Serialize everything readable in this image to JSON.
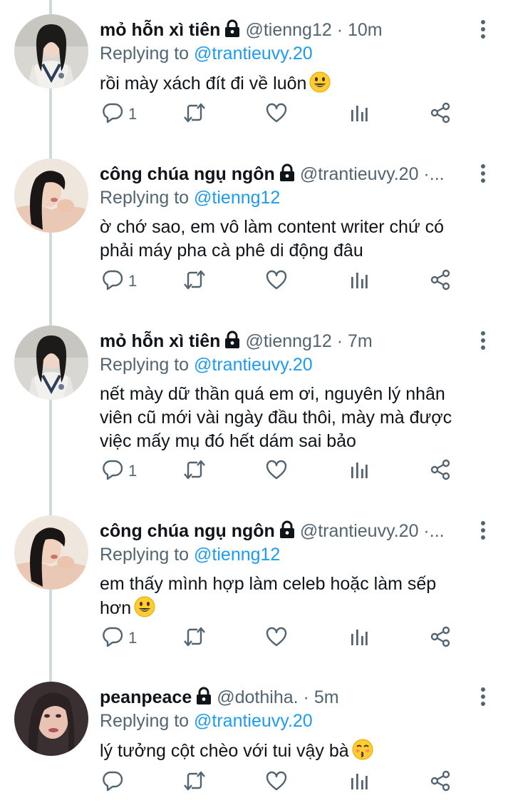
{
  "tweets": [
    {
      "name": "mỏ hỗn xì tiên",
      "handle": "@tienng12",
      "time": "10m",
      "replying_prefix": "Replying to",
      "replying_handle": "@trantieuvy.20",
      "lines": [
        "rồi mày xách đít đi về luôn"
      ],
      "emoji": "grinning-face-emoji",
      "reply_count": "1",
      "avatar": "avatar-girl-school-uniform"
    },
    {
      "name": "công chúa ngụ ngôn",
      "handle": "@trantieuvy.20 ·...",
      "time": "",
      "replying_prefix": "Replying to",
      "replying_handle": "@tienng12",
      "lines": [
        "ờ chớ sao, em vô làm content writer chứ có",
        "phải máy pha cà phê di động đâu"
      ],
      "emoji": "",
      "reply_count": "1",
      "avatar": "avatar-girl-long-hair"
    },
    {
      "name": "mỏ hỗn xì tiên",
      "handle": "@tienng12",
      "time": "7m",
      "replying_prefix": "Replying to",
      "replying_handle": "@trantieuvy.20",
      "lines": [
        "nết mày dữ thần quá em ơi, nguyên lý nhân",
        "viên cũ mới vài ngày đầu thôi, mày mà được",
        "việc mấy mụ đó hết dám sai bảo"
      ],
      "emoji": "",
      "reply_count": "1",
      "avatar": "avatar-girl-school-uniform"
    },
    {
      "name": "công chúa ngụ ngôn",
      "handle": "@trantieuvy.20 ·...",
      "time": "",
      "replying_prefix": "Replying to",
      "replying_handle": "@tienng12",
      "lines": [
        "em thấy mình hợp làm celeb hoặc làm sếp",
        "hơn"
      ],
      "emoji": "grinning-face-emoji",
      "reply_count": "1",
      "avatar": "avatar-girl-long-hair"
    },
    {
      "name": "peanpeace",
      "handle": "@dothiha.",
      "time": "5m",
      "replying_prefix": "Replying to",
      "replying_handle": "@trantieuvy.20",
      "lines": [
        "lý tưởng cột chèo với tui vậy bà"
      ],
      "emoji": "kissing-face-emoji",
      "reply_count": "",
      "avatar": "avatar-girl-portrait"
    }
  ],
  "icons": {
    "reply": "reply-icon",
    "retweet": "retweet-icon",
    "like": "like-icon",
    "analytics": "analytics-icon",
    "share": "share-icon",
    "lock": "lock-icon",
    "more": "more-options-icon"
  },
  "colors": {
    "name": "#0f1419",
    "meta": "#536471",
    "link": "#1d9bf0",
    "thread_line": "#cfd9de",
    "icon": "#536471"
  }
}
